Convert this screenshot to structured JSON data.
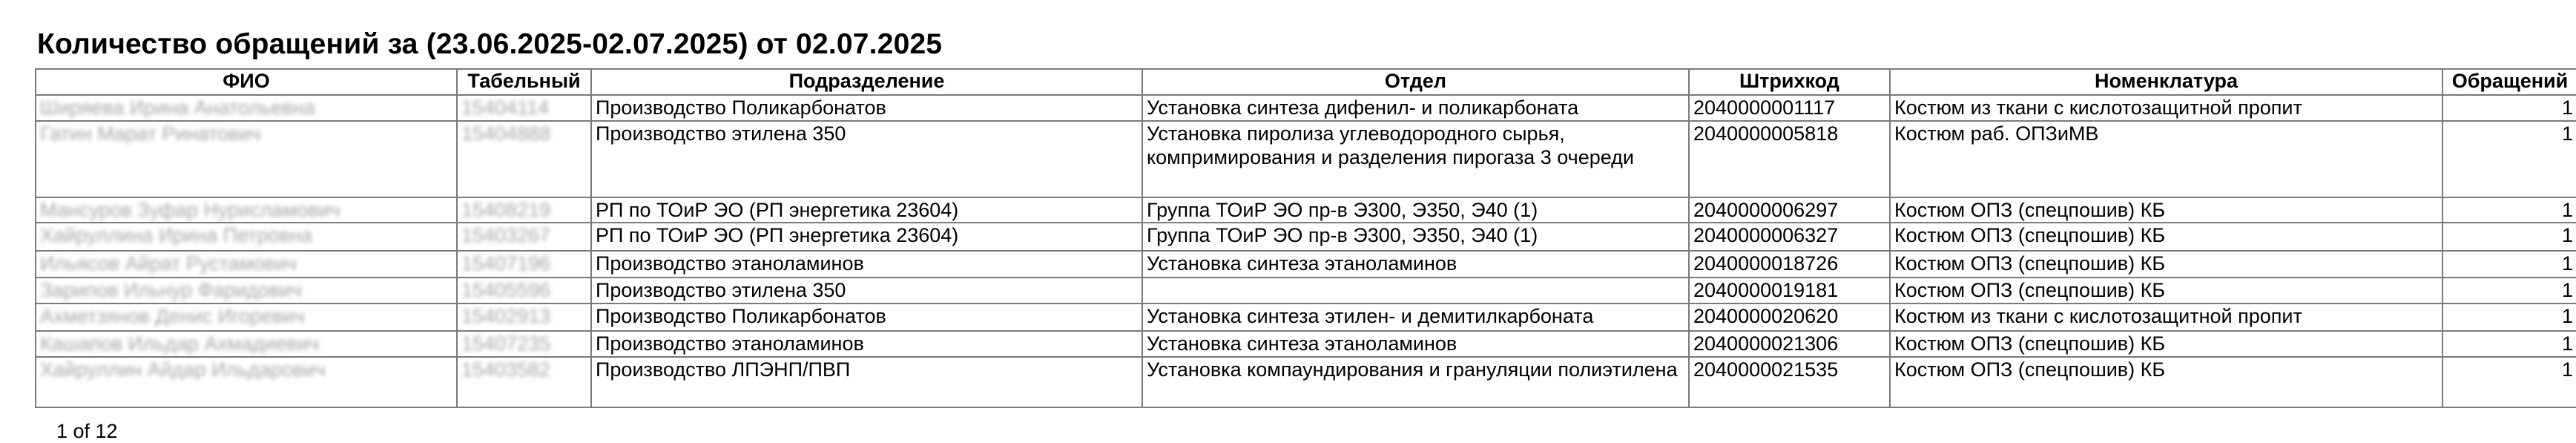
{
  "report": {
    "title": "Количество обращений за (23.06.2025-02.07.2025) от 02.07.2025"
  },
  "table": {
    "columns": [
      "ФИО",
      "Табельный",
      "Подразделение",
      "Отдел",
      "Штрихкод",
      "Номенклатура",
      "Обращений"
    ],
    "rows": [
      {
        "fio": "Ширяева Ирина Анатольевна",
        "tab": "15404114",
        "division": "Производство Поликарбонатов",
        "dept": "Установка синтеза дифенил- и поликарбоната",
        "barcode": "2040000001117",
        "item": "Костюм из ткани с кислотозащитной пропит",
        "count": "1"
      },
      {
        "fio": "Гатин Марат Ринатович",
        "tab": "15404888",
        "division": "Производство этилена 350",
        "dept": "Установка пиролиза углеводородного сырья, компримирования и разделения пирогаза 3 очереди",
        "barcode": "2040000005818",
        "item": "Костюм раб. ОПЗиМВ",
        "count": "1"
      },
      {
        "fio": "Мансуров Зуфар Нурисламович",
        "tab": "15408219",
        "division": "РП по ТОиР ЭО (РП энергетика 23604)",
        "dept": "Группа ТОиР ЭО пр-в Э300, Э350, Э40 (1)",
        "barcode": "2040000006297",
        "item": "Костюм ОПЗ (спецпошив) КБ",
        "count": "1"
      },
      {
        "fio": "Хайруллина Ирина Петровна",
        "tab": "15403267",
        "division": "РП по ТОиР ЭО (РП энергетика 23604)",
        "dept": "Группа ТОиР ЭО пр-в Э300, Э350, Э40 (1)",
        "barcode": "2040000006327",
        "item": "Костюм ОПЗ (спецпошив) КБ",
        "count": "1"
      },
      {
        "fio": "Ильясов Айрат Рустамович",
        "tab": "15407196",
        "division": "Производство этаноламинов",
        "dept": "Установка синтеза этаноламинов",
        "barcode": "2040000018726",
        "item": "Костюм ОПЗ (спецпошив) КБ",
        "count": "1"
      },
      {
        "fio": "Зарипов Ильнур Фаридович",
        "tab": "15405596",
        "division": "Производство этилена 350",
        "dept": "",
        "barcode": "2040000019181",
        "item": "Костюм ОПЗ (спецпошив) КБ",
        "count": "1"
      },
      {
        "fio": "Ахметзянов Денис Игоревич",
        "tab": "15402913",
        "division": "Производство Поликарбонатов",
        "dept": "Установка синтеза этилен- и демитилкарбоната",
        "barcode": "2040000020620",
        "item": "Костюм из ткани с кислотозащитной пропит",
        "count": "1"
      },
      {
        "fio": "Кашапов Ильдар Ахмадиевич",
        "tab": "15407235",
        "division": "Производство этаноламинов",
        "dept": "Установка синтеза этаноламинов",
        "barcode": "2040000021306",
        "item": "Костюм ОПЗ (спецпошив) КБ",
        "count": "1"
      },
      {
        "fio": "Хайруллин Айдар Ильдарович",
        "tab": "15403582",
        "division": "Производство ЛПЭНП/ПВП",
        "dept": "Установка компаундирования и грануляции полиэтилена",
        "barcode": "2040000021535",
        "item": "Костюм ОПЗ (спецпошив) КБ",
        "count": "1"
      }
    ]
  },
  "footer": {
    "page_label": "1 of 12"
  }
}
